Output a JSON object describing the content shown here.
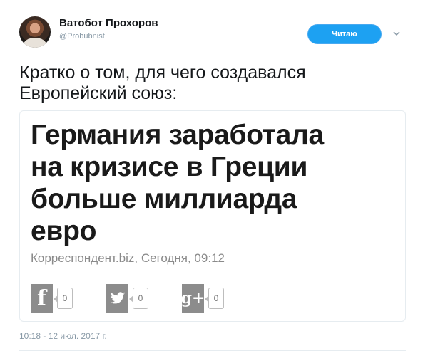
{
  "user": {
    "name": "Ватобот Прохоров",
    "handle": "@Probubnist"
  },
  "follow_button": {
    "label": "Читаю"
  },
  "tweet": {
    "text_line1": "Кратко о том, для чего создавался",
    "text_line2": "Европейский союз:"
  },
  "card": {
    "headline_line1": "Германия заработала",
    "headline_line2": "на кризисе в Греции",
    "headline_line3": "больше миллиарда",
    "headline_line4": "евро",
    "source": "Корреспондент.biz, Сегодня, 09:12",
    "shares": [
      {
        "icon": "facebook-icon",
        "glyph": "f",
        "count": "0"
      },
      {
        "icon": "twitter-icon",
        "glyph": "🐦",
        "count": "0"
      },
      {
        "icon": "google-plus-icon",
        "glyph": "g+",
        "count": "0"
      }
    ]
  },
  "meta": {
    "timestamp": "10:18 - 12 июл. 2017 г."
  },
  "colors": {
    "accent": "#1da1f2",
    "text": "#14171a",
    "muted": "#8899a6"
  }
}
